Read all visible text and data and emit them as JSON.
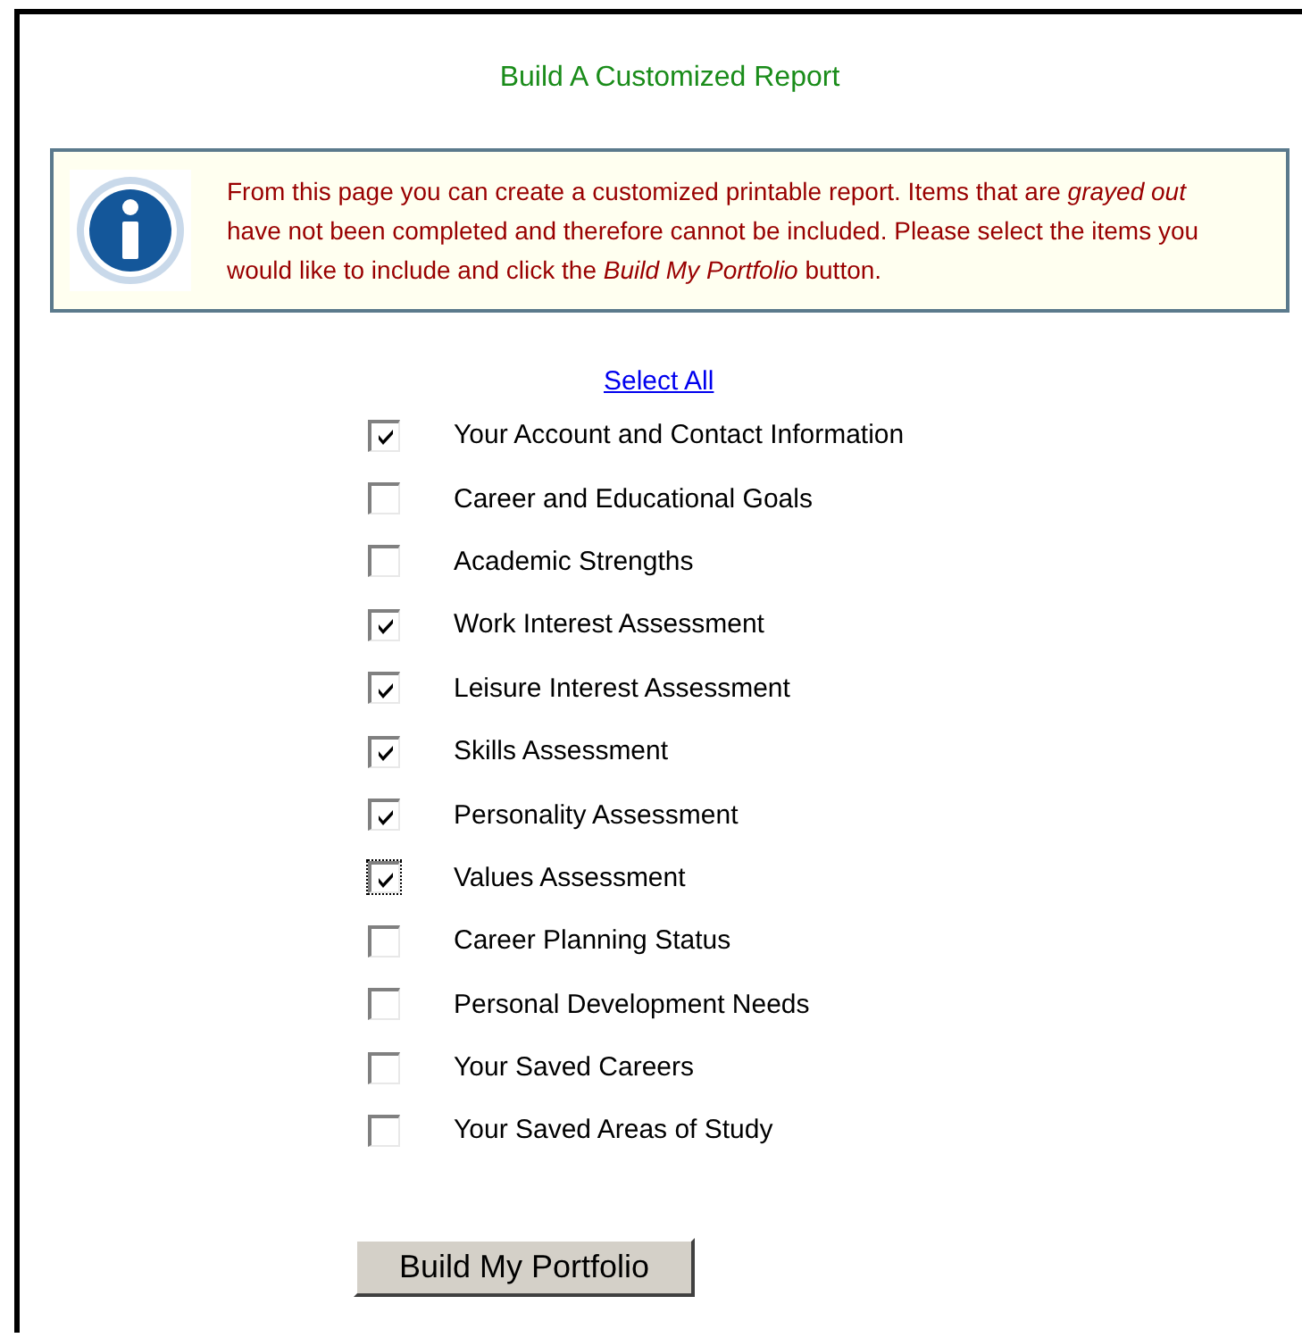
{
  "title": "Build A Customized Report",
  "info": "From this page you can create a customized printable report. Items that are *grayed out* have not been completed and therefore cannot be included. Please select the items you would like to include and click the *Build My Portfolio* button.",
  "select_all": "Select All",
  "items": [
    {
      "label": "Your Account and Contact Information",
      "checked": true,
      "focused": false
    },
    {
      "label": "Career and Educational Goals",
      "checked": false,
      "focused": false
    },
    {
      "label": "Academic Strengths",
      "checked": false,
      "focused": false
    },
    {
      "label": "Work Interest Assessment",
      "checked": true,
      "focused": false
    },
    {
      "label": "Leisure Interest Assessment",
      "checked": true,
      "focused": false
    },
    {
      "label": "Skills Assessment",
      "checked": true,
      "focused": false
    },
    {
      "label": "Personality Assessment",
      "checked": true,
      "focused": false
    },
    {
      "label": "Values Assessment",
      "checked": true,
      "focused": true
    },
    {
      "label": "Career Planning Status",
      "checked": false,
      "focused": false
    },
    {
      "label": "Personal Development Needs",
      "checked": false,
      "focused": false
    },
    {
      "label": "Your Saved Careers",
      "checked": false,
      "focused": false
    },
    {
      "label": "Your Saved Areas of Study",
      "checked": false,
      "focused": false
    }
  ],
  "button": "Build My Portfolio"
}
